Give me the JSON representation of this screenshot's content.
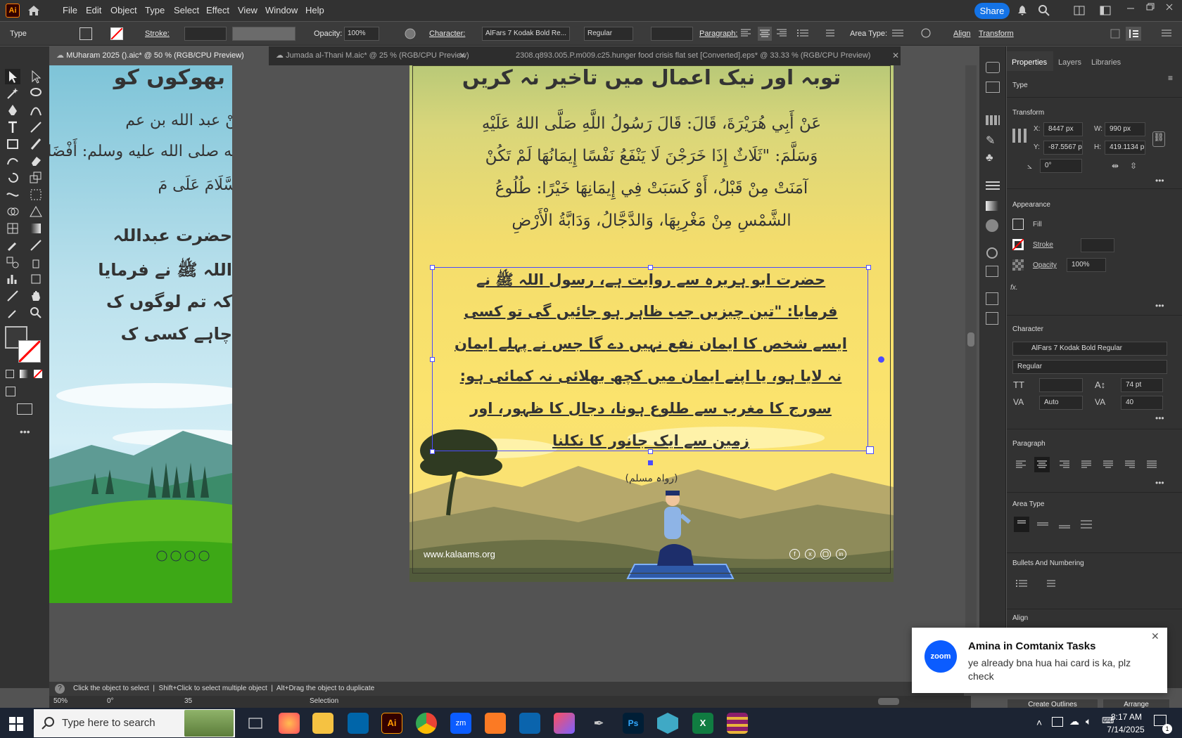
{
  "app": {
    "logo": "Ai"
  },
  "menu": [
    "File",
    "Edit",
    "Object",
    "Type",
    "Select",
    "Effect",
    "View",
    "Window",
    "Help"
  ],
  "menubar_right": {
    "share_label": "Share"
  },
  "control_bar": {
    "tool_name": "Type",
    "stroke_label": "Stroke:",
    "opacity_label": "Opacity:",
    "opacity_value": "100%",
    "character_label": "Character:",
    "font_name": "AlFars 7 Kodak Bold Re...",
    "font_style": "Regular",
    "paragraph_label": "Paragraph:",
    "area_type_label": "Area Type:",
    "align_label": "Align",
    "transform_label": "Transform"
  },
  "tabs": [
    {
      "label": "MUharam 2025 ().aic* @ 50 % (RGB/CPU Preview)",
      "active": true
    },
    {
      "label": "Jumada al-Thani M.aic* @ 25 % (RGB/CPU Preview)",
      "active": false
    },
    {
      "label": "2308.q893.005.P.m009.c25.hunger food crisis flat set [Converted].eps* @ 33.33 % (RGB/CPU Preview)",
      "active": false
    }
  ],
  "left_artboard": {
    "title": "بھوکوں کو",
    "arabic": [
      "عَنْ عبد الله بن عم",
      "الله صلى الله عليه وسلم: أَفْضَلُ الْ",
      "السَّلَامَ عَلَى مَ"
    ],
    "urdu": [
      "حضرت عبداللہ",
      "اللہ ﷺ نے فرمایا",
      "کہ تم لوگوں ک",
      "چاہے کسی ک"
    ]
  },
  "main_artboard": {
    "title": "توبہ اور نیک اعمال میں تاخیر نہ کریں",
    "arabic_lines": [
      "عَنْ أَبِي هُرَيْرَةَ، قَالَ: قَالَ رَسُولُ اللَّهِ صَلَّى اللهُ عَلَيْهِ",
      "وَسَلَّمَ: \"ثَلَاثٌ إِذَا خَرَجْنَ لَا يَنْفَعُ نَفْسًا إِيمَانُهَا لَمْ تَكُنْ",
      "آمَنَتْ مِنْ قَبْلُ، أَوْ كَسَبَتْ فِي إِيمَانِهَا خَيْرًا: طُلُوعُ",
      "الشَّمْسِ مِنْ مَغْرِبِهَا، وَالدَّجَّالُ، وَدَابَّةُ الْأَرْضِ"
    ],
    "urdu_lines": [
      "حضرت ابو ہریرہ سے روایت ہے، رسول اللہ ﷺ نے",
      "فرمایا: \"تین چیزیں جب ظاہر ہو جائیں گی تو کسی",
      "ایسے شخص کا ایمان نفع نہیں دے گا جس نے پہلے ایمان",
      "نہ لایا ہو، یا اپنے ایمان میں کچھ بھلائی نہ کمائی ہو:",
      "سورج کا مغرب سے طلوع ہونا، دجال کا ظہور، اور",
      "زمین سے ایک جانور کا نکلنا"
    ],
    "reference": "(رواہ مسلم)",
    "website": "www.kalaams.org",
    "social_icons": [
      "facebook-icon",
      "x-icon",
      "instagram-icon",
      "linkedin-icon"
    ]
  },
  "properties_panel": {
    "tabs": [
      "Properties",
      "Layers",
      "Libraries"
    ],
    "type_label": "Type",
    "transform": {
      "title": "Transform",
      "x_label": "X:",
      "x": "8447 px",
      "y_label": "Y:",
      "y": "-87.5567 p",
      "w_label": "W:",
      "w": "990 px",
      "h_label": "H:",
      "h": "419.1134 p",
      "angle": "0°"
    },
    "appearance": {
      "title": "Appearance",
      "fill": "Fill",
      "stroke": "Stroke",
      "opacity": "Opacity",
      "opacity_value": "100%",
      "fx": "fx."
    },
    "character": {
      "title": "Character",
      "font": "AlFars 7 Kodak Bold Regular",
      "style": "Regular",
      "size": "74 pt",
      "kerning": "Auto",
      "tracking": "40"
    },
    "paragraph_title": "Paragraph",
    "area_type_title": "Area Type",
    "bullets_title": "Bullets And Numbering",
    "align_title": "Align",
    "create_outlines": "Create Outlines",
    "arrange": "Arrange"
  },
  "status_bar": {
    "hint": "Click the object to select  |  Shift+Click to select multiple object  |  Alt+Drag the object to duplicate",
    "zoom": "50%",
    "angle": "0°",
    "artboard_num": "35",
    "mode": "Selection"
  },
  "toast": {
    "app": "zoom",
    "title": "Amina in Comtanix Tasks",
    "message": "ye already bna hua hai card is ka, plz check"
  },
  "taskbar": {
    "search_placeholder": "Type here to search",
    "time": "8:17 AM",
    "date": "7/14/2025",
    "notif_count": "1",
    "apps": [
      "task-view",
      "firefox",
      "file-explorer",
      "vscode",
      "illustrator",
      "chrome",
      "zoom",
      "xampp",
      "outlook",
      "creative-cloud",
      "inkscape",
      "photoshop",
      "app-hex",
      "excel",
      "winrar"
    ]
  },
  "colors": {
    "accent": "#1473e6",
    "selection": "#4b4bff",
    "artboard_yellow": "#f8dc6a"
  }
}
